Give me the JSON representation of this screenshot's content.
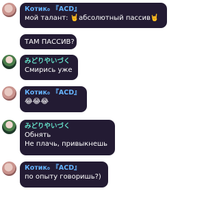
{
  "messages": [
    {
      "sender": "Котик₀ 『ACD』",
      "lines": [
        "мой талант: 🤘абсолютный пассив🤘"
      ]
    },
    {
      "sender": "",
      "lines": [
        "ТАМ ПАССИВ?"
      ]
    },
    {
      "sender": "みどりやいづく",
      "lines": [
        "Смирись уже"
      ]
    },
    {
      "sender": "Котик₀ 『ACD』",
      "lines": [
        "😂😂😂"
      ]
    },
    {
      "sender": "みどりやいづく",
      "lines": [
        "Обнять",
        "Не плачь, привыкнешь"
      ]
    },
    {
      "sender": "Котик₀ 『ACD』",
      "lines": [
        "по опыту говоришь?)"
      ]
    }
  ],
  "icons": {
    "hand": "horns-hand-emoji",
    "laugh": "tears-of-joy-emoji"
  }
}
